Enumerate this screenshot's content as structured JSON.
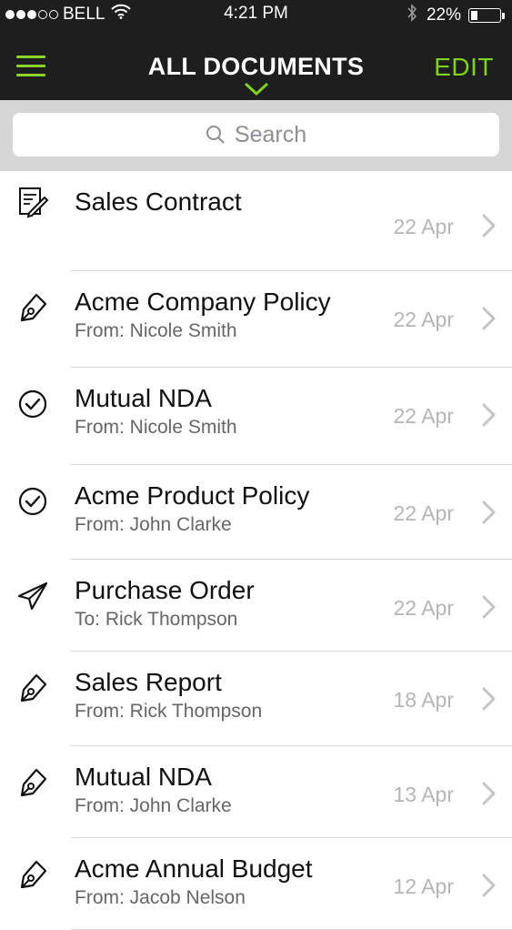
{
  "status_bar": {
    "carrier": "BELL",
    "time": "4:21 PM",
    "battery_percent": "22%",
    "battery_level": 0.22,
    "signal_bars_filled": 3,
    "signal_bars_total": 5
  },
  "nav": {
    "title": "ALL DOCUMENTS",
    "edit_label": "EDIT",
    "menu_icon": "hamburger-icon",
    "accent_color": "#7ed321",
    "bar_color": "#1e1e1e"
  },
  "search": {
    "placeholder": "Search"
  },
  "documents": [
    {
      "icon": "edit-document-icon",
      "title": "Sales Contract",
      "subtitle": "",
      "date": "22 Apr"
    },
    {
      "icon": "pen-nib-icon",
      "title": "Acme Company Policy",
      "subtitle": "From: Nicole Smith",
      "date": "22 Apr"
    },
    {
      "icon": "check-circle-icon",
      "title": "Mutual NDA",
      "subtitle": "From: Nicole Smith",
      "date": "22 Apr"
    },
    {
      "icon": "check-circle-icon",
      "title": "Acme Product Policy",
      "subtitle": "From: John Clarke",
      "date": "22 Apr"
    },
    {
      "icon": "send-icon",
      "title": "Purchase Order",
      "subtitle": "To: Rick Thompson",
      "date": "22 Apr"
    },
    {
      "icon": "pen-nib-icon",
      "title": "Sales Report",
      "subtitle": "From: Rick Thompson",
      "date": "18 Apr"
    },
    {
      "icon": "pen-nib-icon",
      "title": "Mutual NDA",
      "subtitle": "From: John Clarke",
      "date": "13 Apr"
    },
    {
      "icon": "pen-nib-icon",
      "title": "Acme Annual Budget",
      "subtitle": "From: Jacob Nelson",
      "date": "12 Apr"
    }
  ]
}
